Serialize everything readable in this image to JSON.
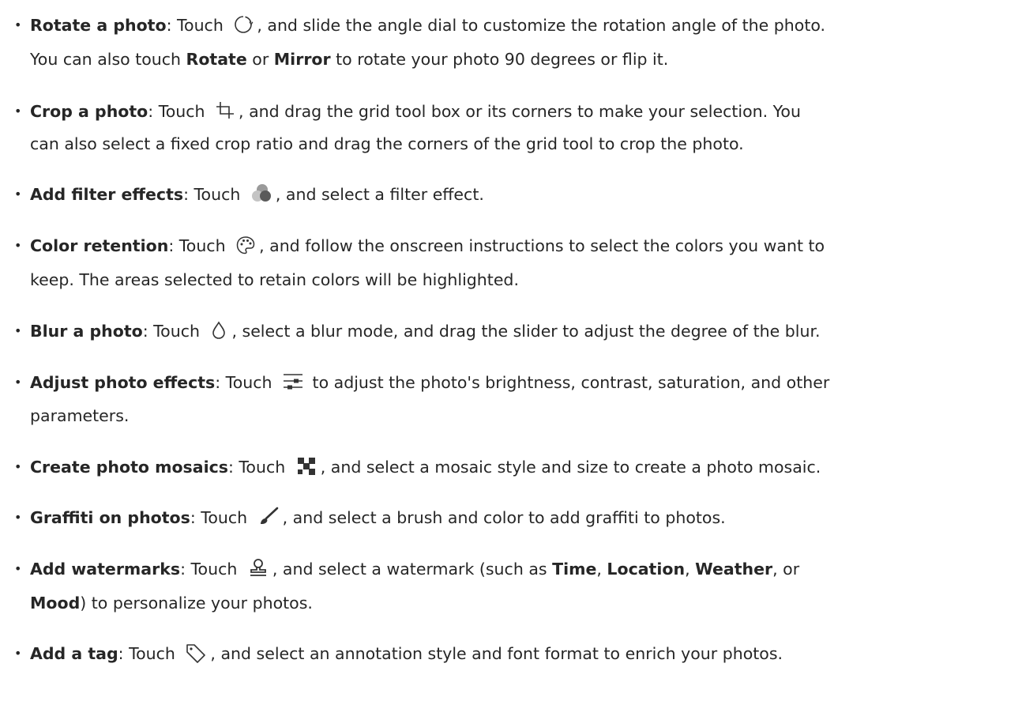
{
  "items": [
    {
      "bullet": "•",
      "title": "Rotate a photo",
      "sep": ": Touch ",
      "icon": "rotate-icon",
      "text1": ", and slide the angle dial to customize the rotation angle of the photo.",
      "line2_a": "You can also touch ",
      "line2_b": "Rotate",
      "line2_c": " or ",
      "line2_d": "Mirror",
      "line2_e": " to rotate your photo 90 degrees or flip it."
    },
    {
      "bullet": "•",
      "title": "Crop a photo",
      "sep": ": Touch ",
      "icon": "crop-icon",
      "text1": ", and drag the grid tool box or its corners to make your selection. You",
      "line2": "can also select a fixed crop ratio and drag the corners of the grid tool to crop the photo."
    },
    {
      "bullet": "•",
      "title": "Add filter effects",
      "sep": ": Touch ",
      "icon": "filter-icon",
      "text1": ", and select a filter effect."
    },
    {
      "bullet": "•",
      "title": "Color retention",
      "sep": ": Touch ",
      "icon": "palette-icon",
      "text1": ", and follow the onscreen instructions to select the colors you want to",
      "line2": "keep. The areas selected to retain colors will be highlighted."
    },
    {
      "bullet": "•",
      "title": "Blur a photo",
      "sep": ": Touch ",
      "icon": "droplet-icon",
      "text1": ", select a blur mode, and drag the slider to adjust the degree of the blur."
    },
    {
      "bullet": "•",
      "title": "Adjust photo effects",
      "sep": ": Touch ",
      "icon": "sliders-icon",
      "text1": " to adjust the photo's brightness, contrast, saturation, and other",
      "line2": "parameters."
    },
    {
      "bullet": "•",
      "title": "Create photo mosaics",
      "sep": ": Touch ",
      "icon": "mosaic-icon",
      "text1": ", and select a mosaic style and size to create a photo mosaic."
    },
    {
      "bullet": "•",
      "title": "Graffiti on photos",
      "sep": ": Touch ",
      "icon": "brush-icon",
      "text1": ", and select a brush and color to add graffiti to photos."
    },
    {
      "bullet": "•",
      "title": "Add watermarks",
      "sep": ": Touch ",
      "icon": "stamp-icon",
      "text1_a": ", and select a watermark (such as ",
      "text1_b": "Time",
      "text1_c": ", ",
      "text1_d": "Location",
      "text1_e": ", ",
      "text1_f": "Weather",
      "text1_g": ", or",
      "line2_a": "Mood",
      "line2_b": ") to personalize your photos."
    },
    {
      "bullet": "•",
      "title": "Add a tag",
      "sep": ": Touch ",
      "icon": "tag-icon",
      "text1": ", and select an annotation style and font format to enrich your photos."
    }
  ]
}
